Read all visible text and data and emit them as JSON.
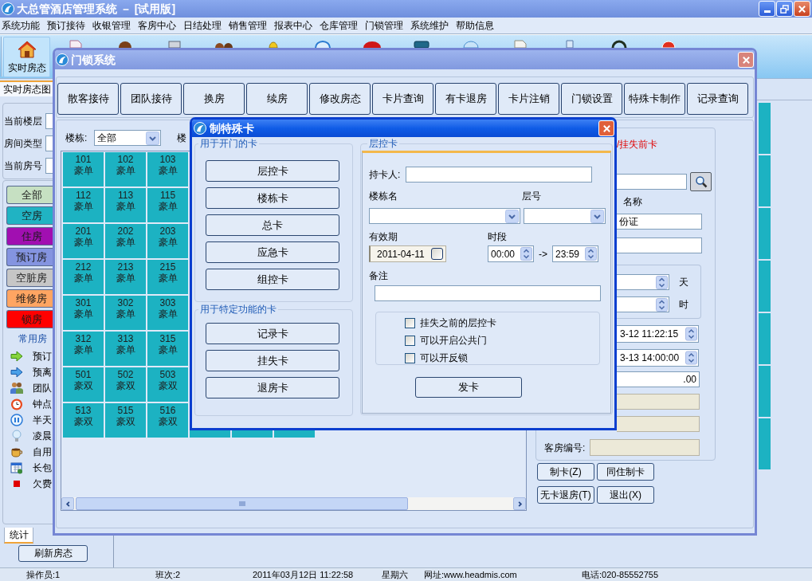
{
  "app_window": {
    "title": "大总管酒店管理系统 － [试用版]"
  },
  "menu_bar": [
    "系统功能",
    "预订接待",
    "收银管理",
    "客房中心",
    "日结处理",
    "销售管理",
    "报表中心",
    "仓库管理",
    "门锁管理",
    "系统维护",
    "帮助信息"
  ],
  "toolbar": {
    "label": "实时房态"
  },
  "left_panel": {
    "tab": "实时房态图",
    "field_labels": [
      "当前楼层",
      "房间类型",
      "当前房号"
    ],
    "status_filters": [
      {
        "label": "全部",
        "color": "#c6e0c2"
      },
      {
        "label": "空房",
        "color": "#20b3c3"
      },
      {
        "label": "住房",
        "color": "#a10fb1"
      },
      {
        "label": "预订房",
        "color": "#8494e0"
      },
      {
        "label": "空脏房",
        "color": "#c6c6c6"
      },
      {
        "label": "维修房",
        "color": "#ffa562"
      },
      {
        "label": "锁房",
        "color": "#ff0000"
      }
    ],
    "legend_title": "常用房",
    "legend": [
      {
        "label": "预订",
        "kind": "greenarrow"
      },
      {
        "label": "预离",
        "kind": "bluearrow"
      },
      {
        "label": "团队",
        "kind": "people"
      },
      {
        "label": "钟点",
        "kind": "clock"
      },
      {
        "label": "半天",
        "kind": "pause"
      },
      {
        "label": "凌晨",
        "kind": "bulb"
      },
      {
        "label": "自用",
        "kind": "cup"
      },
      {
        "label": "长包",
        "kind": "calendar"
      },
      {
        "label": "欠费",
        "kind": "square"
      }
    ],
    "bottom_tab": "统计",
    "refresh_button": "刷新房态"
  },
  "door_lock_window": {
    "title": "门锁系统",
    "buttons": [
      "散客接待",
      "团队接待",
      "换房",
      "续房",
      "修改房态",
      "卡片查询",
      "有卡退房",
      "卡片注销",
      "门锁设置",
      "特殊卡制作",
      "记录查询"
    ],
    "building_label": "楼栋:",
    "building_value": "全部",
    "floor_label": "楼",
    "rooms": [
      {
        "number": "101",
        "type": "豪单"
      },
      {
        "number": "102",
        "type": "豪单"
      },
      {
        "number": "103",
        "type": "豪单"
      },
      {
        "number": "112",
        "type": "豪单"
      },
      {
        "number": "113",
        "type": "豪单"
      },
      {
        "number": "115",
        "type": "豪单"
      },
      {
        "number": "201",
        "type": "豪单"
      },
      {
        "number": "202",
        "type": "豪单"
      },
      {
        "number": "203",
        "type": "豪单"
      },
      {
        "number": "212",
        "type": "豪单"
      },
      {
        "number": "213",
        "type": "豪单"
      },
      {
        "number": "215",
        "type": "豪单"
      },
      {
        "number": "301",
        "type": "豪单"
      },
      {
        "number": "302",
        "type": "豪单"
      },
      {
        "number": "303",
        "type": "豪单"
      },
      {
        "number": "312",
        "type": "豪单"
      },
      {
        "number": "313",
        "type": "豪单"
      },
      {
        "number": "315",
        "type": "豪单"
      },
      {
        "number": "501",
        "type": "豪双"
      },
      {
        "number": "502",
        "type": "豪双"
      },
      {
        "number": "503",
        "type": "豪双"
      },
      {
        "number": "513",
        "type": "豪双"
      },
      {
        "number": "515",
        "type": "豪双"
      },
      {
        "number": "516",
        "type": "豪双"
      }
    ],
    "right_panel": {
      "notice": "/挂失前卡",
      "card_name_label": "名称",
      "id_type": "份证",
      "days_unit": "天",
      "hours_unit": "时",
      "checkin_time": "3-12 11:22:15",
      "checkout_time": "3-13 14:00:00",
      "amount": ".00",
      "room_number_label": "客房编号:",
      "buttons": [
        "制卡(Z)",
        "同住制卡",
        "无卡退房(T)",
        "退出(X)"
      ]
    }
  },
  "special_card_dialog": {
    "title": "制特殊卡",
    "door_cards": {
      "label": "用于开门的卡",
      "buttons": [
        "层控卡",
        "楼栋卡",
        "总卡",
        "应急卡",
        "组控卡"
      ]
    },
    "function_cards": {
      "label": "用于特定功能的卡",
      "buttons": [
        "记录卡",
        "挂失卡",
        "退房卡"
      ]
    },
    "form": {
      "label": "层控卡",
      "holder_label": "持卡人:",
      "building_label": "楼栋名",
      "floor_label": "层号",
      "validity_label": "有效期",
      "validity_date": "2011-04-11",
      "validity_checked": false,
      "period_label": "时段",
      "period_start": "00:00",
      "period_separator": "->",
      "period_end": "23:59",
      "remark_label": "备注",
      "options": [
        {
          "label": "挂失之前的层控卡",
          "checked": false
        },
        {
          "label": "可以开启公共门",
          "checked": false
        },
        {
          "label": "可以开反锁",
          "checked": false
        }
      ],
      "issue_button": "发卡"
    }
  },
  "status_bar": [
    "操作员:1",
    "班次:2",
    "2011年03月12日 11:22:58",
    "星期六",
    "网址:www.headmis.com",
    "电话:020-85552755"
  ]
}
